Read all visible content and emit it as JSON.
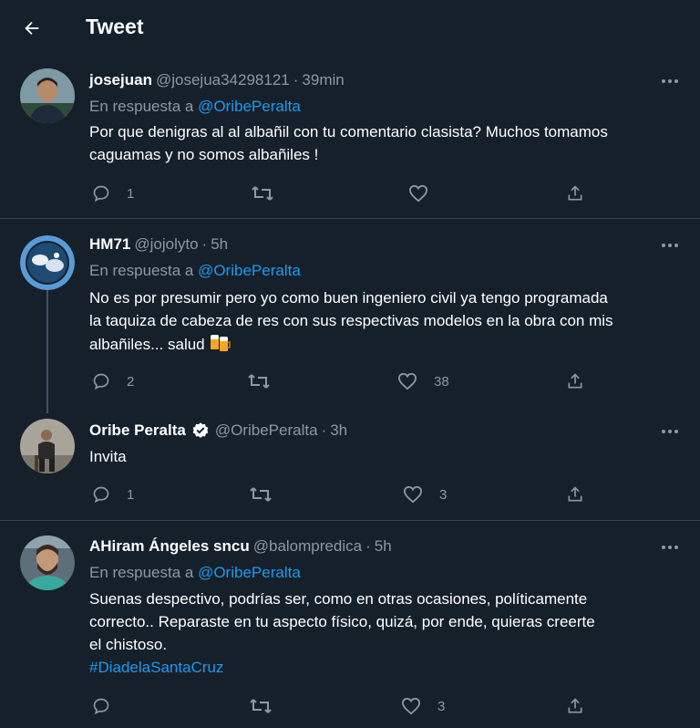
{
  "header": {
    "title": "Tweet"
  },
  "tweets": [
    {
      "name": "josejuan",
      "handle": "@josejua34298121",
      "time": "39min",
      "reply_prefix": "En respuesta a ",
      "reply_to": "@OribePeralta",
      "lines": [
        "Por que denigras al al albañil con tu comentario clasista? Muchos tomamos",
        "caguamas y no somos albañiles !"
      ],
      "replies": "1",
      "retweets": "",
      "likes": ""
    },
    {
      "name": "HM71",
      "handle": "@jojolyto",
      "time": "5h",
      "reply_prefix": "En respuesta a ",
      "reply_to": "@OribePeralta",
      "lines": [
        "No es por presumir pero yo como buen ingeniero civil ya tengo programada",
        "la taquiza de cabeza de res con sus respectivas modelos en la obra con mis",
        "albañiles... salud"
      ],
      "emoji": "beer-mugs",
      "replies": "2",
      "retweets": "",
      "likes": "38"
    },
    {
      "name": "Oribe Peralta",
      "verified": true,
      "handle": "@OribePeralta",
      "time": "3h",
      "lines": [
        "Invita"
      ],
      "replies": "1",
      "retweets": "",
      "likes": "3"
    },
    {
      "name": "AHiram Ángeles sncu",
      "handle": "@balompredica",
      "time": "5h",
      "reply_prefix": "En respuesta a ",
      "reply_to": "@OribePeralta",
      "lines": [
        "Suenas despectivo, podrías ser, como en otras ocasiones, políticamente",
        "correcto.. Reparaste en tu aspecto físico, quizá, por ende, quieras creerte",
        "el chistoso."
      ],
      "hashtag": "#DiadelaSantaCruz",
      "replies": "",
      "retweets": "",
      "likes": "3"
    }
  ],
  "colors": {
    "background": "#15202b",
    "text": "#ffffff",
    "secondary": "#8b98a5",
    "accent": "#1d9bf0",
    "divider": "#38444d"
  },
  "icons": [
    "back-arrow-icon",
    "reply-icon",
    "retweet-icon",
    "like-icon",
    "share-icon",
    "more-icon",
    "verified-badge-icon"
  ]
}
